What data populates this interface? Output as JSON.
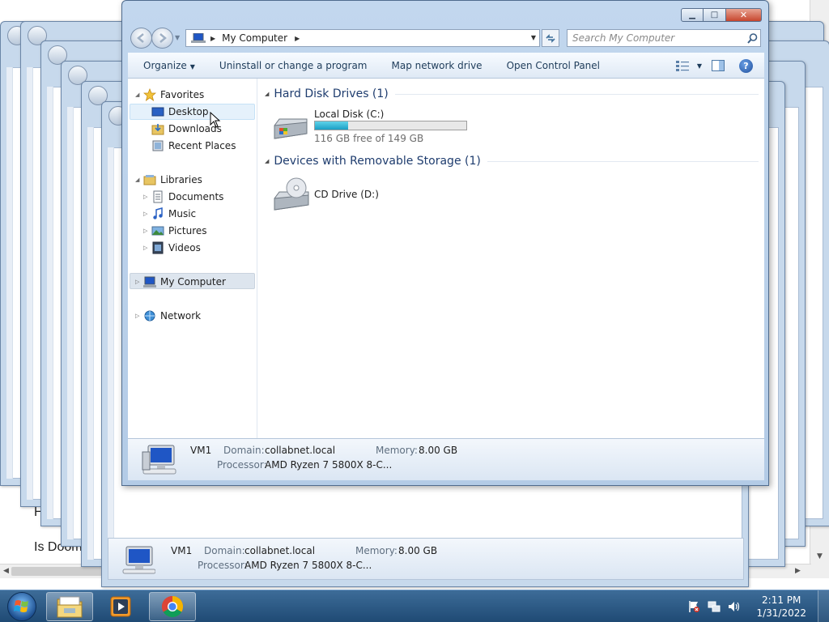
{
  "colors": {
    "accent": "#1e3c6e",
    "selection": "#cde6f7",
    "drive_fill": "#26a7cf",
    "close_button": "#c7452d",
    "taskbar": "#2a5580"
  },
  "background": {
    "text_line_1": "H",
    "text_line_2": "Is Doom"
  },
  "window": {
    "caption_buttons": {
      "minimize": "▁",
      "maximize": "□",
      "close": "✕"
    },
    "address": {
      "computer_icon": "computer-icon",
      "path": "My Computer"
    },
    "search": {
      "placeholder": "Search My Computer"
    },
    "toolbar": {
      "organize": "Organize",
      "uninstall": "Uninstall or change a program",
      "map_drive": "Map network drive",
      "control_panel": "Open Control Panel",
      "help": "?"
    },
    "nav_pane": {
      "favorites": "Favorites",
      "desktop": "Desktop",
      "downloads": "Downloads",
      "recent_places": "Recent Places",
      "libraries": "Libraries",
      "documents": "Documents",
      "music": "Music",
      "pictures": "Pictures",
      "videos": "Videos",
      "my_computer": "My Computer",
      "network": "Network"
    },
    "content": {
      "hard_disk_header": "Hard Disk Drives (1)",
      "local_disk_name": "Local Disk (C:)",
      "local_disk_used_fraction": 0.22,
      "local_disk_free": "116 GB free of 149 GB",
      "removable_header": "Devices with Removable Storage (1)",
      "cd_drive_name": "CD Drive (D:)"
    },
    "details": {
      "name": "VM1",
      "domain_label": "Domain:",
      "domain_value": "collabnet.local",
      "memory_label": "Memory:",
      "memory_value": "8.00 GB",
      "processor_label": "Processor:",
      "processor_value": "AMD Ryzen 7 5800X 8-C..."
    }
  },
  "back_details": {
    "name": "VM1",
    "domain_label": "Domain:",
    "domain_value": "collabnet.local",
    "memory_label": "Memory:",
    "memory_value": "8.00 GB",
    "processor_label": "Processor:",
    "processor_value": "AMD Ryzen 7 5800X 8-C..."
  },
  "taskbar": {
    "time": "2:11 PM",
    "date": "1/31/2022",
    "apps": [
      "windows-explorer",
      "media-player",
      "chrome"
    ]
  }
}
